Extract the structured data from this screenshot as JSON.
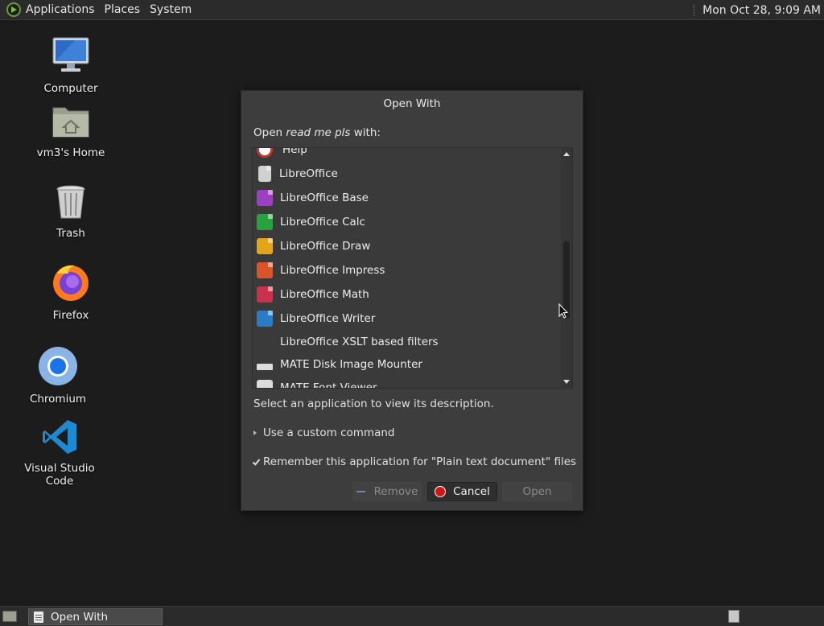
{
  "top_panel": {
    "menus": [
      "Applications",
      "Places",
      "System"
    ],
    "clock": "Mon Oct 28,  9:09 AM"
  },
  "desktop": {
    "icons": [
      {
        "label": "Computer",
        "icon": "computer-icon"
      },
      {
        "label": "vm3's Home",
        "icon": "home-folder-icon"
      },
      {
        "label": "Trash",
        "icon": "trash-icon"
      },
      {
        "label": "Firefox",
        "icon": "firefox-icon"
      },
      {
        "label": "Chromium",
        "icon": "chromium-icon"
      },
      {
        "label": "Visual Studio Code",
        "icon": "vscode-icon"
      }
    ]
  },
  "dialog": {
    "title": "Open With",
    "prompt_prefix": "Open ",
    "prompt_filename": "read me pls",
    "prompt_suffix": " with:",
    "apps": [
      {
        "label": "Help",
        "icon": "help-icon",
        "color": "#c0392b"
      },
      {
        "label": "LibreOffice",
        "icon": "libreoffice-icon",
        "color": "#d0d0d0"
      },
      {
        "label": "LibreOffice Base",
        "icon": "libreoffice-base-icon",
        "color": "#9c3fc1"
      },
      {
        "label": "LibreOffice Calc",
        "icon": "libreoffice-calc-icon",
        "color": "#2aa13f"
      },
      {
        "label": "LibreOffice Draw",
        "icon": "libreoffice-draw-icon",
        "color": "#e2a418"
      },
      {
        "label": "LibreOffice Impress",
        "icon": "libreoffice-impress-icon",
        "color": "#d9542b"
      },
      {
        "label": "LibreOffice Math",
        "icon": "libreoffice-math-icon",
        "color": "#c7324c"
      },
      {
        "label": "LibreOffice Writer",
        "icon": "libreoffice-writer-icon",
        "color": "#2a7cc7"
      },
      {
        "label": "LibreOffice XSLT based filters",
        "icon": "",
        "color": ""
      },
      {
        "label": "MATE Disk Image Mounter",
        "icon": "disk-image-icon",
        "color": "#dcdcdc"
      },
      {
        "label": "MATE Font Viewer",
        "icon": "font-viewer-icon",
        "color": "#dcdcdc"
      }
    ],
    "description": "Select an application to view its description.",
    "custom_command": "Use a custom command",
    "remember": "Remember this application for \"Plain text document\" files",
    "remember_checked": true,
    "buttons": {
      "remove": "Remove",
      "cancel": "Cancel",
      "open": "Open"
    }
  },
  "bottom_panel": {
    "task_label": "Open With"
  }
}
